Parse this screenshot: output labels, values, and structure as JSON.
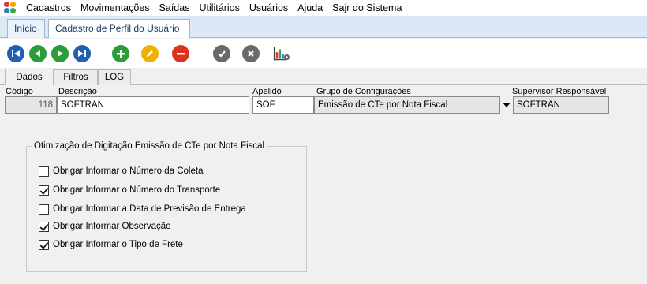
{
  "menu": {
    "items": [
      "Cadastros",
      "Movimentações",
      "Saídas",
      "Utilitários",
      "Usuários",
      "Ajuda",
      "Sajr do Sistema"
    ]
  },
  "doc_tabs": {
    "home": "Início",
    "profile": "Cadastro de Perfil do Usuário",
    "close_glyph": "⊠"
  },
  "toolbar": {
    "icons": [
      "first-icon",
      "previous-icon",
      "next-icon",
      "last-icon",
      "add-icon",
      "edit-icon",
      "delete-icon",
      "confirm-icon",
      "cancel-icon",
      "report-icon"
    ],
    "colors": {
      "nav": "#1f5fb4",
      "add": "#2a9d3a",
      "edit": "#f0b000",
      "delete": "#e0301e",
      "gray": "#6a6a6a"
    }
  },
  "inner_tabs": [
    "Dados",
    "Filtros",
    "LOG"
  ],
  "form": {
    "codigo_label": "Código",
    "codigo_value": "118",
    "descricao_label": "Descrição",
    "descricao_value": "SOFTRAN",
    "apelido_label": "Apelido",
    "apelido_value": "SOF",
    "grupo_label": "Grupo de Configurações",
    "grupo_value": "Emissão de CTe por Nota Fiscal",
    "supervisor_label": "Supervisor Responsável",
    "supervisor_value": "SOFTRAN"
  },
  "group": {
    "title": "Otimização de Digitação Emissão de CTe por  Nota Fiscal",
    "options": [
      {
        "label": "Obrigar Informar o Número da Coleta",
        "checked": false
      },
      {
        "label": "Obrigar Informar o Número do Transporte",
        "checked": true
      },
      {
        "label": "Obrigar Informar a Data de Previsão de Entrega",
        "checked": false
      },
      {
        "label": "Obrigar Informar Observação",
        "checked": true
      },
      {
        "label": "Obrigar Informar o Tipo de Frete",
        "checked": true
      }
    ]
  }
}
